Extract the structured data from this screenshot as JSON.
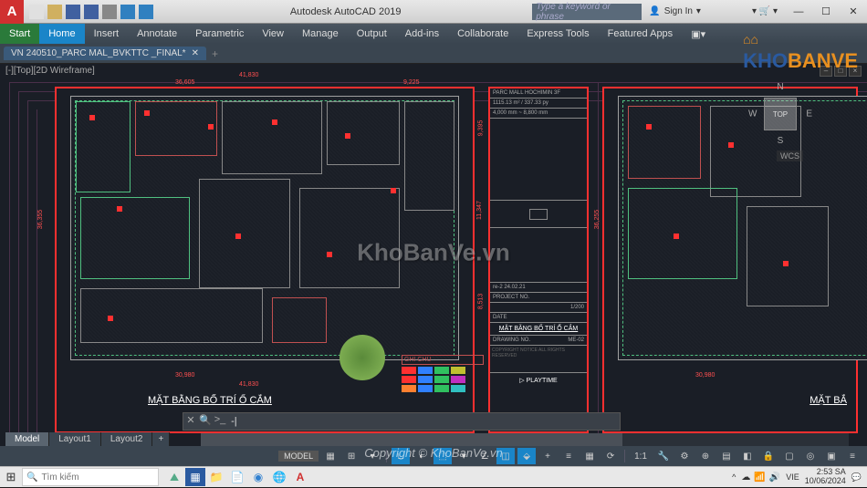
{
  "app": {
    "title": "Autodesk AutoCAD 2019",
    "icon_letter": "A"
  },
  "search": {
    "placeholder": "Type a keyword or phrase"
  },
  "signin": {
    "label": "Sign In"
  },
  "ribbon": {
    "start": "Start",
    "tabs": [
      "Home",
      "Insert",
      "Annotate",
      "Parametric",
      "View",
      "Manage",
      "Output",
      "Add-ins",
      "Collaborate",
      "Express Tools",
      "Featured Apps"
    ],
    "active": 0
  },
  "file_tab": {
    "name": "VN 240510_PARC MAL_BVKTTC _FINAL*"
  },
  "viewport": {
    "label": "[-][Top][2D Wireframe]"
  },
  "viewcube": {
    "face": "TOP",
    "n": "N",
    "s": "S",
    "e": "E",
    "w": "W",
    "wcs": "WCS"
  },
  "dimensions": {
    "top1": "36,605",
    "top2": "41,830",
    "top3": "9,225",
    "left1": "36,355",
    "right1": "9,395",
    "right2": "11,347",
    "right3": "8,513",
    "right_mid": "36,255",
    "bottom1": "30,980",
    "bottom2": "41,830",
    "r_left": "36,255",
    "r_bottom": "30,980"
  },
  "drawing": {
    "title": "MẶT BẰNG BỐ TRÍ Ổ CẮM",
    "title_r": "MẶT BẮ",
    "legend_header": "GHI CHÚ"
  },
  "titleblock": {
    "project_line1": "PARC MALL HOCHIMIN 3F",
    "project_line2": "1115.13 m² / 337.33 py",
    "project_line3": "4,000 mm ~ 8,800 mm",
    "rev": "re-2  24.02.21",
    "proj_label": "PROJECT NO.",
    "scale": "1/200",
    "date_label": "DATE",
    "sheet_title": "MẶT BẰNG BỐ TRÍ Ổ CẮM",
    "dwg_label": "DRAWING NO.",
    "dwg_no": "ME-02",
    "brand": "▷ PLAYTIME"
  },
  "cmdline": {
    "prompt": ">_",
    "value": "-|"
  },
  "layout_tabs": [
    "Model",
    "Layout1",
    "Layout2"
  ],
  "statusbar": {
    "model": "MODEL",
    "scale": "1:1"
  },
  "watermark": "KhoBanVe.vn",
  "copyright": "Copyright © KhoBanVe.vn",
  "logo": {
    "part1": "KHO",
    "part2": "BANVE"
  },
  "taskbar": {
    "search_placeholder": "Tìm kiếm",
    "lang": "VIE",
    "time": "2:53 SA",
    "date": "10/06/2024"
  }
}
